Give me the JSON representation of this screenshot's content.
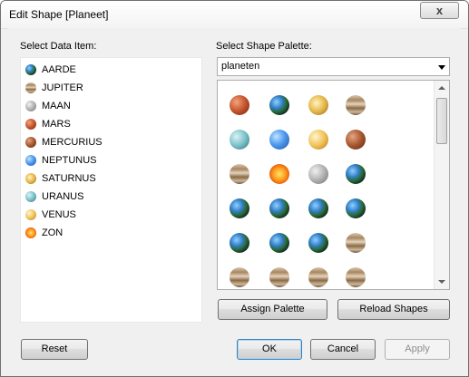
{
  "window": {
    "title": "Edit Shape [Planeet]",
    "close_glyph": "x"
  },
  "data_items": {
    "label": "Select Data Item:",
    "items": [
      {
        "label": "AARDE",
        "icon": "earth-icon"
      },
      {
        "label": "JUPITER",
        "icon": "jupiter-icon"
      },
      {
        "label": "MAAN",
        "icon": "moon-icon"
      },
      {
        "label": "MARS",
        "icon": "mars-icon"
      },
      {
        "label": "MERCURIUS",
        "icon": "mercury-icon"
      },
      {
        "label": "NEPTUNUS",
        "icon": "neptune-icon"
      },
      {
        "label": "SATURNUS",
        "icon": "saturn-icon"
      },
      {
        "label": "URANUS",
        "icon": "uranus-icon"
      },
      {
        "label": "VENUS",
        "icon": "venus-icon"
      },
      {
        "label": "ZON",
        "icon": "sun-icon"
      }
    ]
  },
  "palette": {
    "label": "Select Shape Palette:",
    "selected": "planeten",
    "shapes": [
      "mars-icon",
      "earth-icon",
      "saturn-icon",
      "jupiter-icon",
      "uranus-icon",
      "neptune-icon",
      "venus-icon",
      "mercury-icon",
      "jupiter-icon",
      "sun-icon",
      "moon-icon",
      "earth-icon",
      "earth-icon",
      "earth-icon",
      "earth-icon",
      "earth-icon",
      "earth-icon",
      "earth-icon",
      "earth-icon",
      "jupiter-icon",
      "jupiter-icon",
      "jupiter-icon",
      "jupiter-icon",
      "jupiter-icon"
    ]
  },
  "buttons": {
    "assign_palette": "Assign Palette",
    "reload_shapes": "Reload Shapes",
    "reset": "Reset",
    "ok": "OK",
    "cancel": "Cancel",
    "apply": "Apply"
  },
  "colors": {
    "window_bg": "#f0f0f0",
    "default_button_border": "#3c7fb1"
  }
}
